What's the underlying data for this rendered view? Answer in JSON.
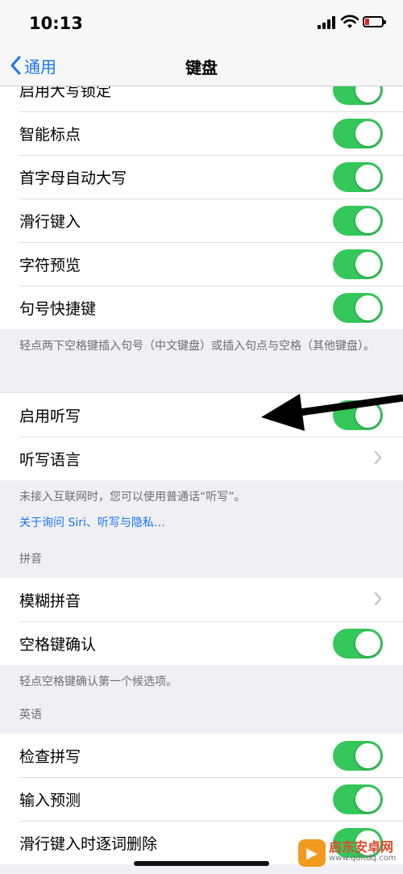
{
  "status": {
    "time": "10:13"
  },
  "nav": {
    "back_label": "通用",
    "title": "键盘"
  },
  "group1": [
    {
      "label": "启用大写锁定",
      "on": true
    },
    {
      "label": "智能标点",
      "on": true
    },
    {
      "label": "首字母自动大写",
      "on": true
    },
    {
      "label": "滑行键入",
      "on": true
    },
    {
      "label": "字符预览",
      "on": true
    },
    {
      "label": "句号快捷键",
      "on": true
    }
  ],
  "note1": "轻点两下空格键插入句号（中文键盘）或插入句点与空格（其他键盘）。",
  "group2": [
    {
      "label": "启用听写",
      "on": true
    },
    {
      "label": "听写语言"
    }
  ],
  "note2": "未接入互联网时，您可以使用普通话“听写”。",
  "link_about": "关于询问 Siri、听写与隐私…",
  "pinyin_header": "拼音",
  "group3": [
    {
      "label": "模糊拼音"
    },
    {
      "label": "空格键确认",
      "on": true
    }
  ],
  "note3": "轻点空格键确认第一个候选项。",
  "english_header": "英语",
  "group4": [
    {
      "label": "检查拼写",
      "on": true
    },
    {
      "label": "输入预测",
      "on": true
    },
    {
      "label": "滑行键入时逐词删除",
      "on": true
    }
  ],
  "watermark": {
    "name": "启东安卓网",
    "url": "www.qdltdq.com"
  },
  "colors": {
    "accent": "#1976f2",
    "toggle_on": "#34c759",
    "background": "#efeff4"
  }
}
